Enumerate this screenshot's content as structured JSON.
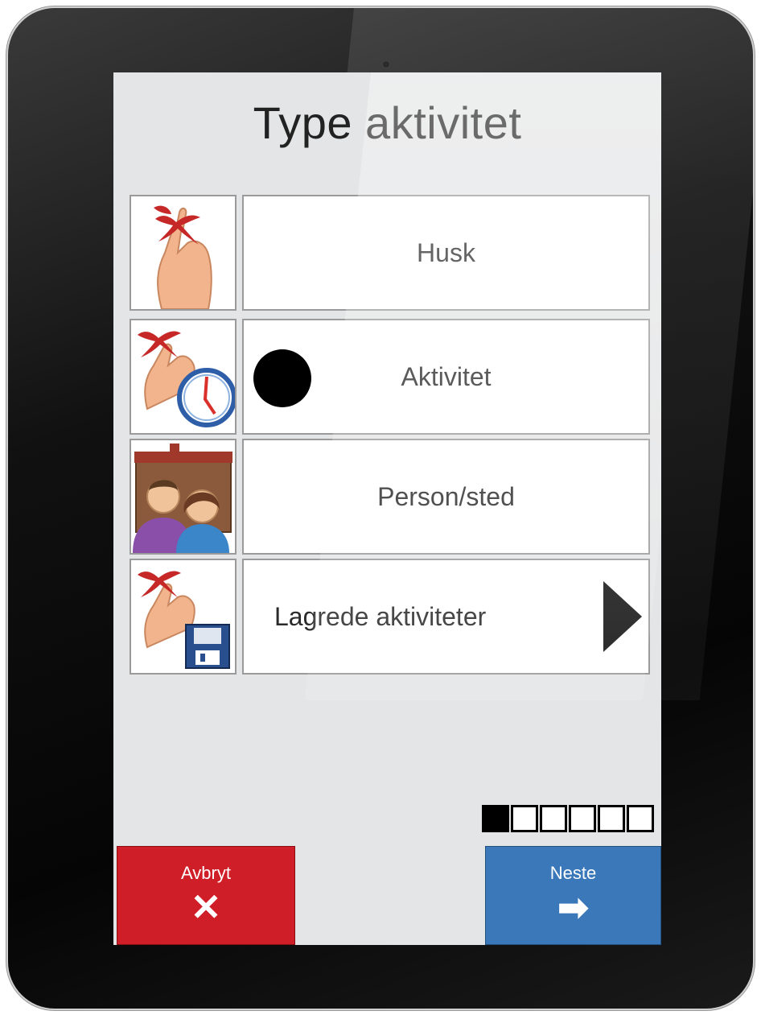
{
  "screen": {
    "title": "Type aktivitet",
    "options": [
      {
        "label": "Husk",
        "icon": "string-finger-icon"
      },
      {
        "label": "Aktivitet",
        "icon": "string-finger-clock-icon",
        "marker": "selected-dot"
      },
      {
        "label": "Person/sted",
        "icon": "people-house-icon"
      },
      {
        "label": "Lagrede aktiviteter",
        "icon": "string-finger-floppy-icon",
        "chevron": "chevron-right-icon"
      }
    ],
    "pager": {
      "total": 6,
      "current": 1
    },
    "cancel_button": {
      "label": "Avbryt",
      "icon": "close-icon",
      "glyph": "✕",
      "color": "#cf1e27"
    },
    "next_button": {
      "label": "Neste",
      "icon": "arrow-right-icon",
      "glyph": "➡",
      "color": "#3a78b9"
    }
  }
}
